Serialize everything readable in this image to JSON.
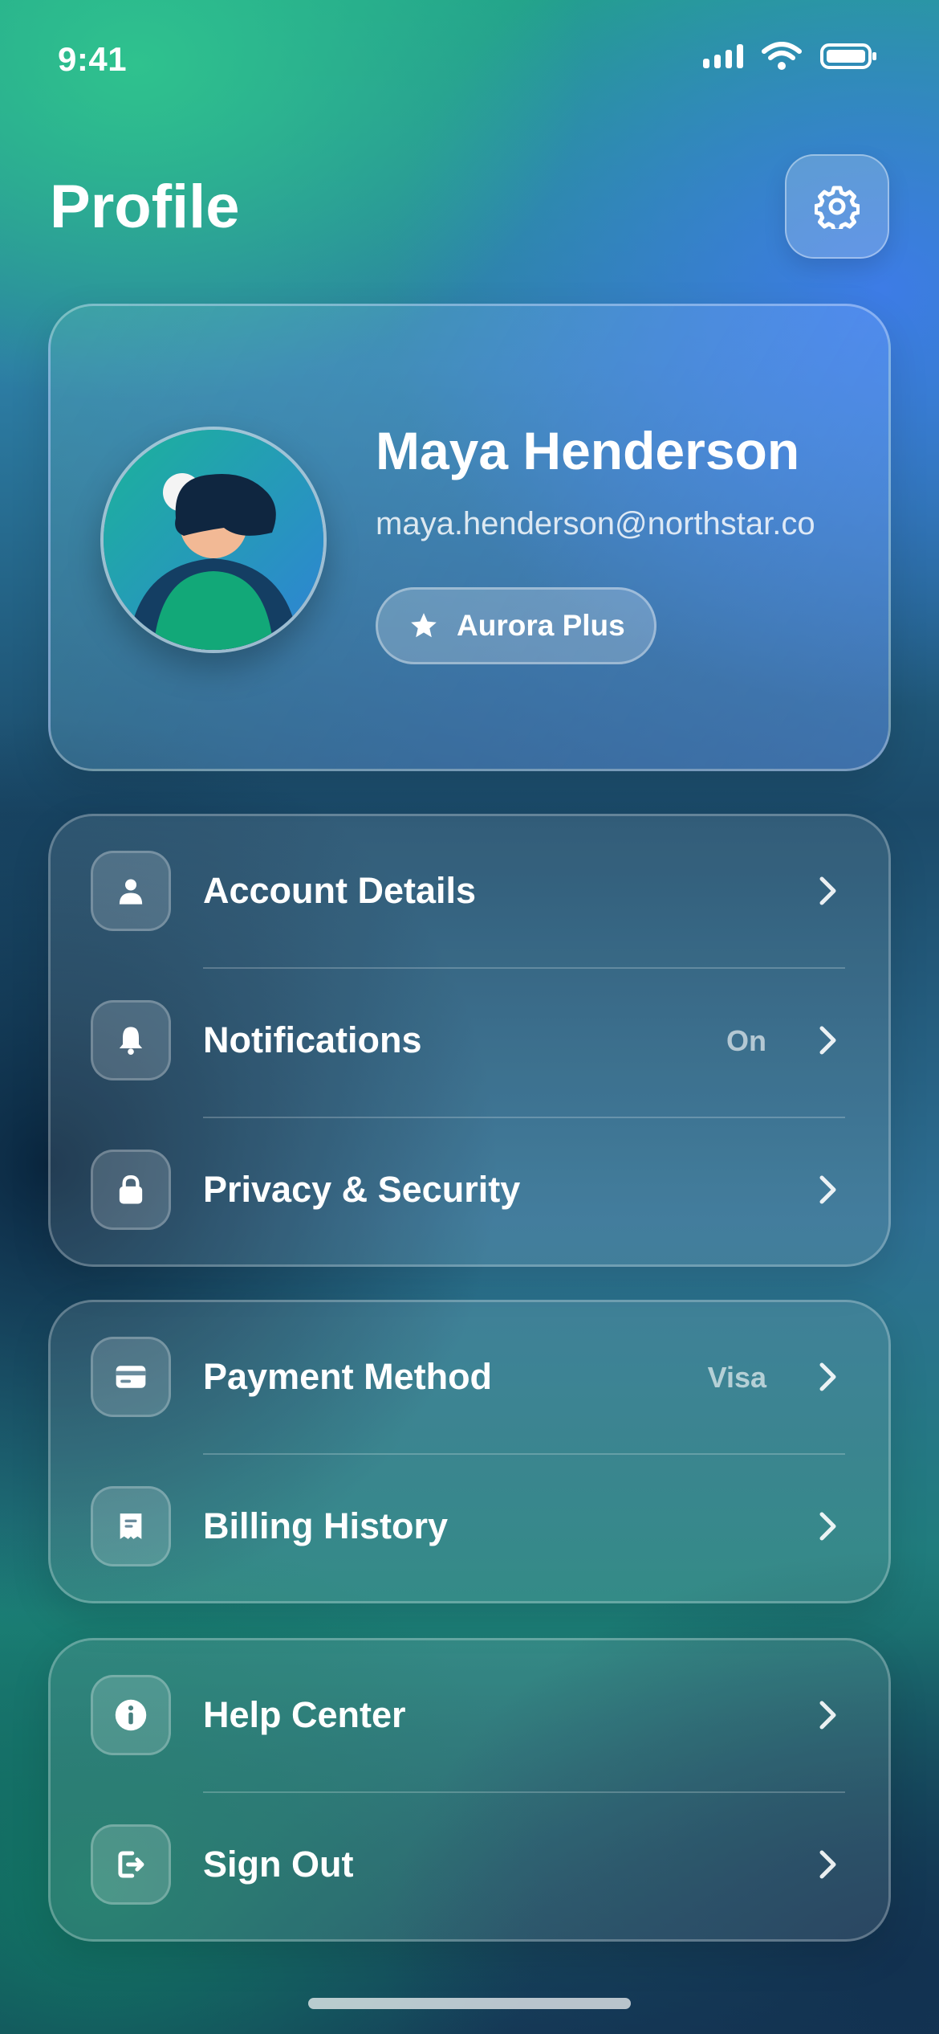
{
  "status_bar": {
    "time": "9:41"
  },
  "header": {
    "title": "Profile"
  },
  "profile": {
    "name": "Maya Henderson",
    "email": "maya.henderson@northstar.co",
    "plan_badge": "Aurora Plus"
  },
  "groups": [
    {
      "items": [
        {
          "label": "Account Details",
          "value": "",
          "icon": "person-icon"
        },
        {
          "label": "Notifications",
          "value": "On",
          "icon": "bell-icon"
        },
        {
          "label": "Privacy & Security",
          "value": "",
          "icon": "lock-icon"
        }
      ]
    },
    {
      "items": [
        {
          "label": "Payment Method",
          "value": "Visa",
          "icon": "credit-card-icon"
        },
        {
          "label": "Billing History",
          "value": "",
          "icon": "receipt-icon"
        }
      ]
    },
    {
      "items": [
        {
          "label": "Help Center",
          "value": "",
          "icon": "info-icon"
        },
        {
          "label": "Sign Out",
          "value": "",
          "icon": "sign-out-icon"
        }
      ]
    }
  ],
  "colors": {
    "accent_green": "#2fc28e",
    "accent_blue": "#3d7ce6",
    "avatar_shirt": "#12a878"
  }
}
